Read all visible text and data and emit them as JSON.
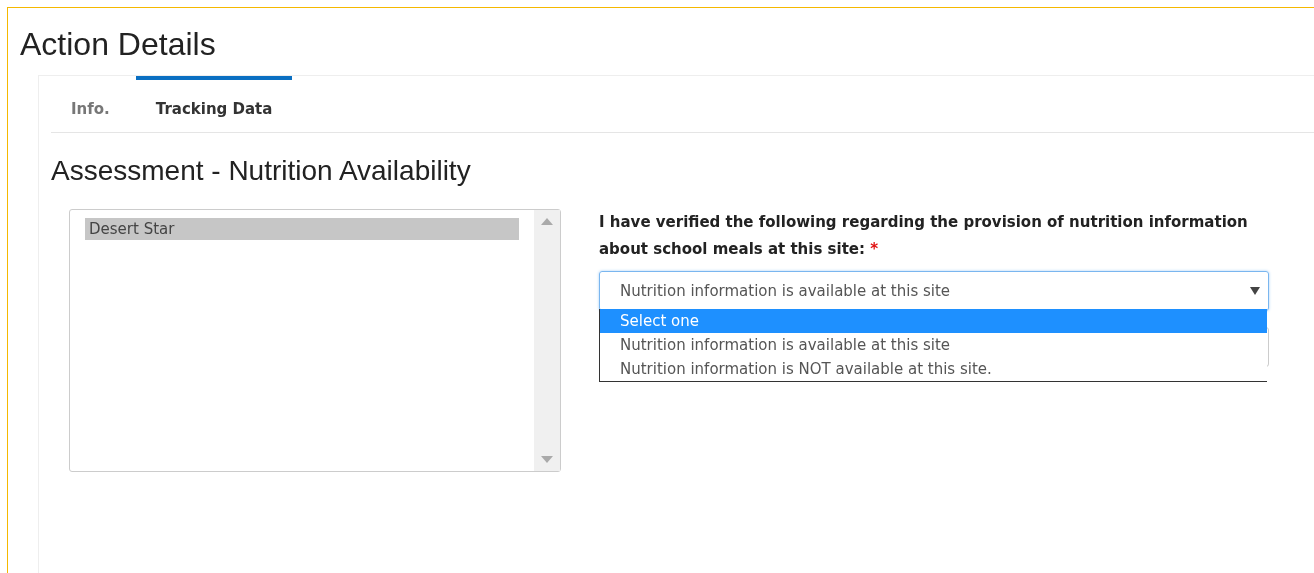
{
  "page_title": "Action Details",
  "tabs": [
    {
      "label": "Info.",
      "selected": false
    },
    {
      "label": "Tracking Data",
      "selected": true
    }
  ],
  "section_title": "Assessment - Nutrition Availability",
  "site_list": {
    "items": [
      {
        "label": "Desert Star",
        "selected": true
      }
    ]
  },
  "question": {
    "label": "I have verified the following regarding the provision of nutrition information about school meals at this site:",
    "required_mark": "*",
    "select": {
      "value": "Nutrition information is available at this site",
      "expanded": true,
      "options": [
        {
          "label": "Select one",
          "highlighted": true
        },
        {
          "label": "Nutrition information is available at this site",
          "highlighted": false
        },
        {
          "label": "Nutrition information is NOT available at this site.",
          "highlighted": false
        }
      ]
    }
  }
}
